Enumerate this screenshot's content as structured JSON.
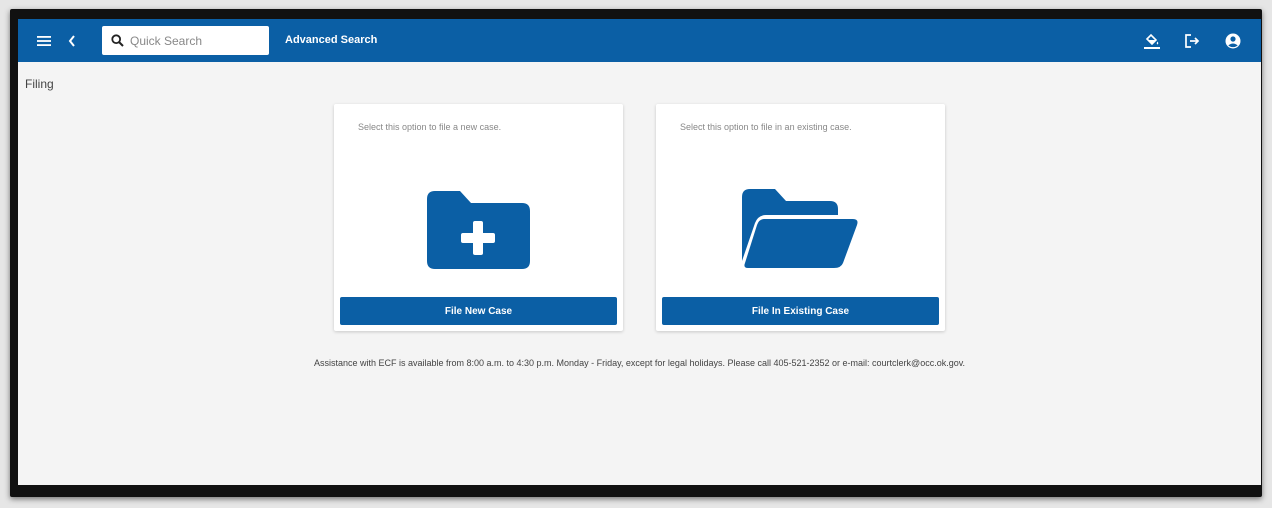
{
  "header": {
    "search_placeholder": "Quick Search",
    "advanced_search_label": "Advanced Search",
    "icons": {
      "menu": "menu-icon",
      "back": "chevron-left-icon",
      "search": "search-icon",
      "theme": "paint-bucket-icon",
      "logout": "logout-icon",
      "account": "account-circle-icon"
    }
  },
  "page": {
    "title": "Filing"
  },
  "cards": {
    "new_case": {
      "description": "Select this option to file a new case.",
      "button_label": "File New Case",
      "icon": "folder-plus-icon"
    },
    "existing_case": {
      "description": "Select this option to file in an existing case.",
      "button_label": "File In Existing Case",
      "icon": "folder-open-icon"
    }
  },
  "footer": {
    "assistance_text": "Assistance with ECF is available from 8:00 a.m. to 4:30 p.m. Monday - Friday, except for legal holidays. Please call 405-521-2352 or e-mail: courtclerk@occ.ok.gov."
  },
  "colors": {
    "primary": "#0b5fa5",
    "background": "#f4f4f4",
    "card": "#ffffff",
    "frame": "#111111"
  }
}
